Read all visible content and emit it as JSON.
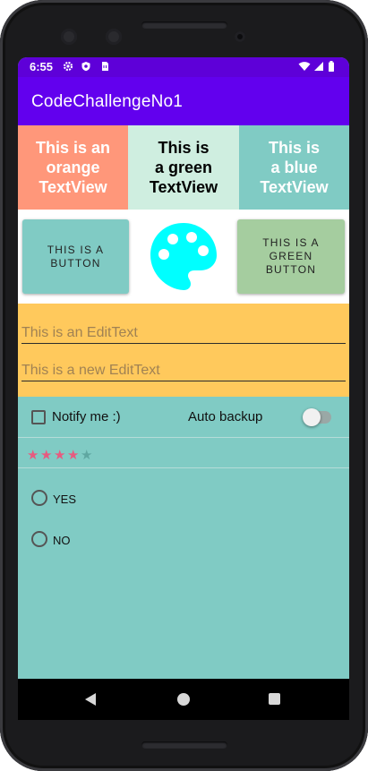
{
  "colors": {
    "status_bar": "#5e00d8",
    "app_bar": "#6200ee",
    "orange": "#ff977a",
    "green_light": "#cfeee0",
    "teal": "#80cbc4",
    "green_button": "#a5cd9f",
    "edit_background": "#ffc95c",
    "star_filled": "#e75b7f",
    "star_empty": "#5fa7a1",
    "palette_icon": "#00ffff"
  },
  "status_bar": {
    "time": "6:55",
    "icons": [
      "gear-icon",
      "shield-icon",
      "sim-card-icon",
      "wifi-icon",
      "signal-icon",
      "battery-icon"
    ]
  },
  "app_bar": {
    "title": "CodeChallengeNo1"
  },
  "text_views": {
    "orange": [
      "This is an",
      "orange",
      "TextView"
    ],
    "green": [
      "This is",
      "a green",
      "TextView"
    ],
    "blue": [
      "This is",
      "a blue",
      "TextView"
    ]
  },
  "buttons": {
    "button_lines": [
      "THIS IS A",
      "BUTTON"
    ],
    "green_button_lines": [
      "THIS IS A",
      "GREEN",
      "BUTTON"
    ]
  },
  "image_icon": "palette-icon",
  "edit_texts": {
    "first_hint": "This is an EditText",
    "second_hint": "This is a new EditText"
  },
  "checkbox": {
    "label": "Notify me :)",
    "checked": false
  },
  "switch": {
    "label": "Auto backup",
    "on": false
  },
  "rating": {
    "value": 4,
    "max": 5
  },
  "radio_group": {
    "options": [
      {
        "label": "YES",
        "selected": false
      },
      {
        "label": "NO",
        "selected": false
      }
    ]
  },
  "nav_bar": {
    "icons": [
      "back-icon",
      "home-icon",
      "recents-icon"
    ]
  }
}
